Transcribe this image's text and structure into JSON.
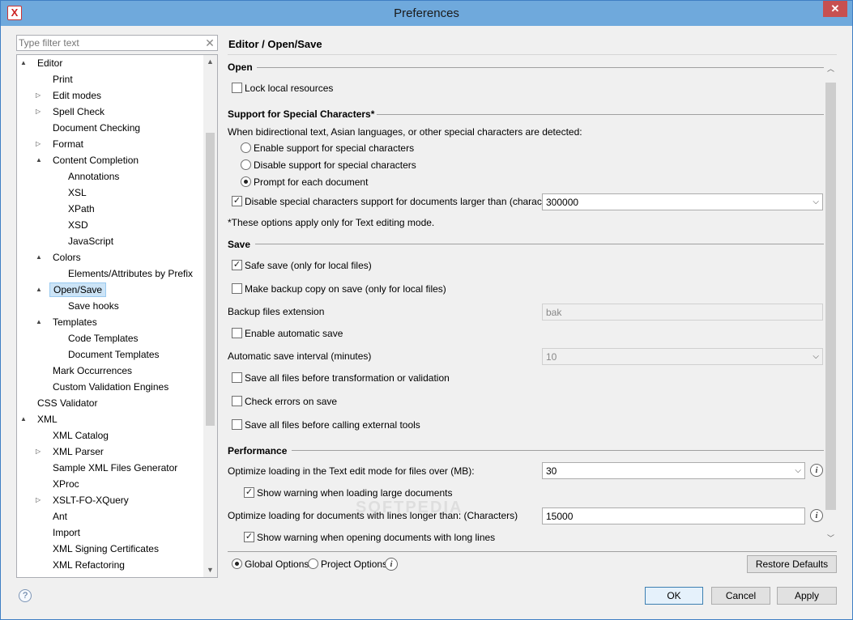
{
  "window": {
    "title": "Preferences",
    "close_glyph": "✕",
    "app_icon_glyph": "X"
  },
  "filter": {
    "placeholder": "Type filter text",
    "clear_glyph": "✕"
  },
  "tree": {
    "items": [
      {
        "label": "Editor",
        "arrow": "▲"
      },
      {
        "label": "Print",
        "arrow": ""
      },
      {
        "label": "Edit modes",
        "arrow": "▷"
      },
      {
        "label": "Spell Check",
        "arrow": "▷"
      },
      {
        "label": "Document Checking",
        "arrow": ""
      },
      {
        "label": "Format",
        "arrow": "▷"
      },
      {
        "label": "Content Completion",
        "arrow": "▲"
      },
      {
        "label": "Annotations",
        "arrow": ""
      },
      {
        "label": "XSL",
        "arrow": ""
      },
      {
        "label": "XPath",
        "arrow": ""
      },
      {
        "label": "XSD",
        "arrow": ""
      },
      {
        "label": "JavaScript",
        "arrow": ""
      },
      {
        "label": "Colors",
        "arrow": "▲"
      },
      {
        "label": "Elements/Attributes by Prefix",
        "arrow": ""
      },
      {
        "label": "Open/Save",
        "arrow": "▲"
      },
      {
        "label": "Save hooks",
        "arrow": ""
      },
      {
        "label": "Templates",
        "arrow": "▲"
      },
      {
        "label": "Code Templates",
        "arrow": ""
      },
      {
        "label": "Document Templates",
        "arrow": ""
      },
      {
        "label": "Mark Occurrences",
        "arrow": ""
      },
      {
        "label": "Custom Validation Engines",
        "arrow": ""
      },
      {
        "label": "CSS Validator",
        "arrow": ""
      },
      {
        "label": "XML",
        "arrow": "▲"
      },
      {
        "label": "XML Catalog",
        "arrow": ""
      },
      {
        "label": "XML Parser",
        "arrow": "▷"
      },
      {
        "label": "Sample XML Files Generator",
        "arrow": ""
      },
      {
        "label": "XProc",
        "arrow": ""
      },
      {
        "label": "XSLT-FO-XQuery",
        "arrow": "▷"
      },
      {
        "label": "Ant",
        "arrow": ""
      },
      {
        "label": "Import",
        "arrow": ""
      },
      {
        "label": "XML Signing Certificates",
        "arrow": ""
      },
      {
        "label": "XML Refactoring",
        "arrow": ""
      }
    ],
    "scroll_up": "▲",
    "scroll_down": "▼"
  },
  "page": {
    "heading": "Editor / Open/Save"
  },
  "open": {
    "title": "Open",
    "lock_local": "Lock local resources"
  },
  "special": {
    "title": "Support for Special Characters*",
    "intro": "When bidirectional text, Asian languages, or other special characters are detected:",
    "enable": "Enable support for special characters",
    "disable": "Disable support for special characters",
    "prompt": "Prompt for each document",
    "disable_large": "Disable special characters support for documents larger than (characters):",
    "disable_large_value": "300000",
    "note": "*These options apply only for Text editing mode."
  },
  "save": {
    "title": "Save",
    "safe_save": "Safe save (only for local files)",
    "backup_copy": "Make backup copy on save (only for local files)",
    "backup_ext_label": "Backup files extension",
    "backup_ext_value": "bak",
    "auto_save": "Enable automatic save",
    "auto_interval_label": "Automatic save interval (minutes)",
    "auto_interval_value": "10",
    "save_before_transform": "Save all files before transformation or validation",
    "check_errors": "Check errors on save",
    "save_before_tools": "Save all files before calling external tools"
  },
  "performance": {
    "title": "Performance",
    "optimize_mb_label": "Optimize loading in the Text edit mode for files over (MB):",
    "optimize_mb_value": "30",
    "warn_large": "Show warning when loading large documents",
    "optimize_lines_label": "Optimize loading for documents with lines longer than: (Characters)",
    "optimize_lines_value": "15000",
    "warn_long_lines": "Show warning when opening documents with long lines"
  },
  "options_scope": {
    "global": "Global Options",
    "project": "Project Options"
  },
  "buttons": {
    "restore": "Restore Defaults",
    "ok": "OK",
    "cancel": "Cancel",
    "apply": "Apply"
  },
  "glyphs": {
    "check": "✓",
    "dropdown": "⌵",
    "info": "i",
    "help": "?",
    "scroll_up": "︿",
    "scroll_down": "﹀"
  },
  "watermark": "SOFTPEDIA"
}
